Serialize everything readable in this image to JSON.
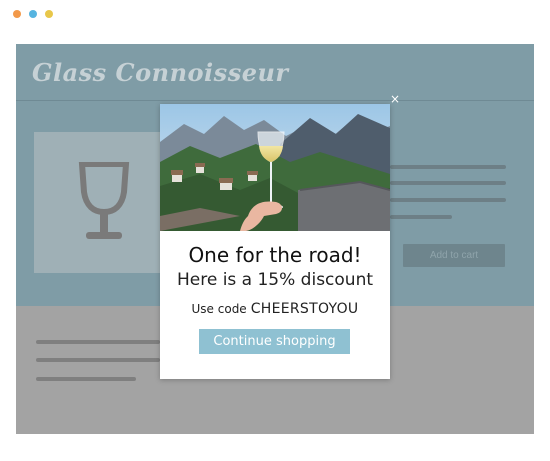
{
  "window": {
    "dots": [
      {
        "name": "close-dot",
        "color": "#f2994a"
      },
      {
        "name": "minimize-dot",
        "color": "#56b4e0"
      },
      {
        "name": "zoom-dot",
        "color": "#e8c74a"
      }
    ]
  },
  "site": {
    "logo": "Glass Connoisseur",
    "add_to_cart": "Add to cart",
    "product_icon": "wine-glass-icon"
  },
  "popup": {
    "close_label": "×",
    "title": "One for the road!",
    "subtitle": "Here is a 15% discount",
    "code_prefix": "Use code",
    "code": "CHEERSTOYOU",
    "button": "Continue shopping",
    "accent": "#8fc1d2"
  }
}
